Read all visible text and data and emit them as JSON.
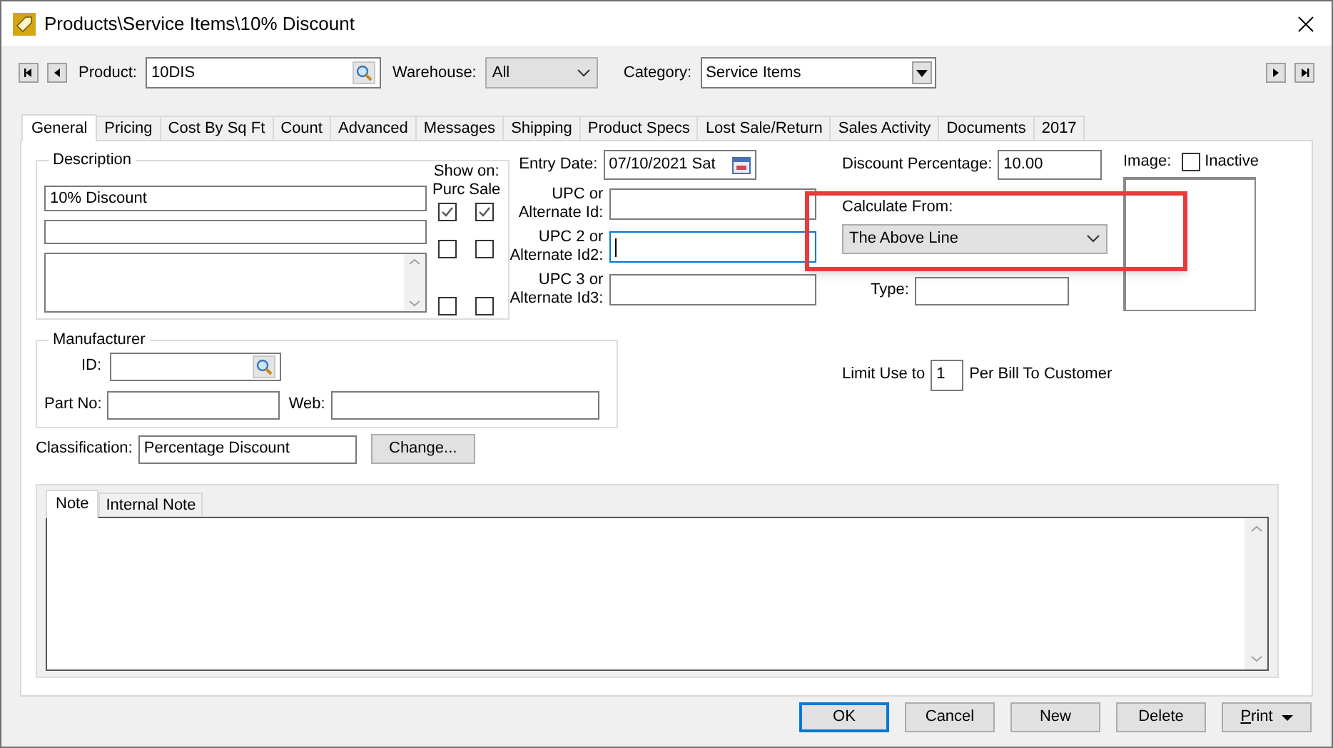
{
  "window": {
    "title": "Products\\Service Items\\10% Discount"
  },
  "toolbar": {
    "product": {
      "label": "Product:",
      "value": "10DIS"
    },
    "warehouse": {
      "label": "Warehouse:",
      "value": "All"
    },
    "category": {
      "label": "Category:",
      "value": "Service Items"
    }
  },
  "tabs": [
    {
      "label": "General",
      "selected": true
    },
    {
      "label": "Pricing",
      "selected": false
    },
    {
      "label": "Cost By Sq Ft",
      "selected": false
    },
    {
      "label": "Count",
      "selected": false
    },
    {
      "label": "Advanced",
      "selected": false
    },
    {
      "label": "Messages",
      "selected": false
    },
    {
      "label": "Shipping",
      "selected": false
    },
    {
      "label": "Product Specs",
      "selected": false
    },
    {
      "label": "Lost Sale/Return",
      "selected": false
    },
    {
      "label": "Sales Activity",
      "selected": false
    },
    {
      "label": "Documents",
      "selected": false
    },
    {
      "label": "2017",
      "selected": false
    }
  ],
  "description": {
    "legend": "Description",
    "show_on": "Show on:",
    "columns": [
      "Purc",
      "Sale"
    ],
    "lines": [
      {
        "kind": "single",
        "value": "10% Discount",
        "purc": true,
        "sale": true
      },
      {
        "kind": "single",
        "purc": false,
        "sale": false
      },
      {
        "kind": "multiline",
        "purc": false,
        "sale": false
      }
    ]
  },
  "entry_date": {
    "label": "Entry Date:",
    "value": "07/10/2021 Sat"
  },
  "upc": [
    {
      "label_lines": [
        "UPC or",
        "Alternate Id:"
      ],
      "focused": false
    },
    {
      "label_lines": [
        "UPC 2 or",
        "Alternate Id2:"
      ],
      "focused": true
    },
    {
      "label_lines": [
        "UPC 3 or",
        "Alternate Id3:"
      ],
      "focused": false
    }
  ],
  "manufacturer": {
    "legend": "Manufacturer",
    "id_label": "ID:",
    "part_no_label": "Part No:",
    "web_label": "Web:"
  },
  "classification": {
    "label": "Classification:",
    "value": "Percentage Discount",
    "button": "Change..."
  },
  "discount": {
    "label": "Discount Percentage:",
    "value": "10.00"
  },
  "calculate_from": {
    "label": "Calculate From:",
    "value": "The Above Line"
  },
  "type": {
    "label": "Type:"
  },
  "limit": {
    "prefix": "Limit Use to",
    "value": "1",
    "suffix": "Per Bill To Customer"
  },
  "image": {
    "label": "Image:"
  },
  "inactive": {
    "label": "Inactive",
    "checked": false
  },
  "note_tabs": [
    {
      "label": "Note",
      "selected": true
    },
    {
      "label": "Internal Note",
      "selected": false
    }
  ],
  "buttons": [
    {
      "label": "OK",
      "kind": "default"
    },
    {
      "label": "Cancel",
      "kind": "plain"
    },
    {
      "label": "New",
      "kind": "plain"
    },
    {
      "label": "Delete",
      "kind": "plain"
    },
    {
      "label": "Print",
      "kind": "menu"
    }
  ]
}
